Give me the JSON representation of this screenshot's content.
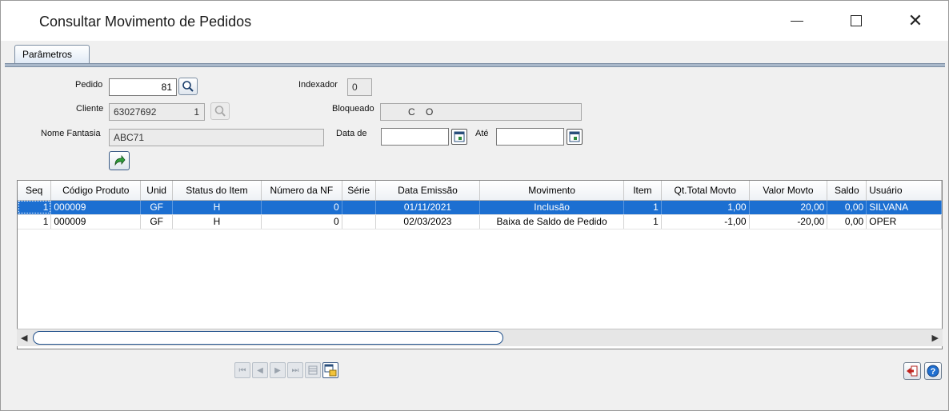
{
  "window": {
    "title": "Consultar Movimento de Pedidos",
    "minimize_glyph": "—",
    "close_glyph": "✕"
  },
  "tabs": [
    {
      "label": "Parâmetros"
    }
  ],
  "form": {
    "pedido_label": "Pedido",
    "pedido_value": "81",
    "indexador_label": "Indexador",
    "indexador_value": "0",
    "cliente_label": "Cliente",
    "cliente_code": "63027692",
    "cliente_num": "1",
    "bloqueado_label": "Bloqueado",
    "bloqueado_value": "C    O",
    "nome_fantasia_label": "Nome Fantasia",
    "nome_fantasia_value": "ABC71",
    "data_de_label": "Data de",
    "data_de_value": "",
    "ate_label": "Até",
    "ate_value": ""
  },
  "grid": {
    "columns": [
      "Seq",
      "Código Produto",
      "Unid",
      "Status do Item",
      "Número da NF",
      "Série",
      "Data Emissão",
      "Movimento",
      "Item",
      "Qt.Total Movto",
      "Valor Movto",
      "Saldo",
      "Usuário"
    ],
    "rows": [
      {
        "seq": "1",
        "codigo": "000009",
        "unid": "GF",
        "status": "H",
        "nf": "0",
        "serie": "",
        "data": "01/11/2021",
        "movimento": "Inclusão",
        "item": "1",
        "qt": "1,00",
        "valor": "20,00",
        "saldo": "0,00",
        "usuario": "SILVANA"
      },
      {
        "seq": "1",
        "codigo": "000009",
        "unid": "GF",
        "status": "H",
        "nf": "0",
        "serie": "",
        "data": "02/03/2023",
        "movimento": "Baixa de Saldo de Pedido",
        "item": "1",
        "qt": "-1,00",
        "valor": "-20,00",
        "saldo": "0,00",
        "usuario": "OPER"
      }
    ],
    "selected_row": 0
  },
  "icons": {
    "search": "search-icon",
    "refresh": "green-arrow-icon",
    "calendar": "calendar-icon",
    "exit": "exit-icon",
    "help": "help-icon"
  },
  "colors": {
    "selection": "#1c6fd1",
    "tab_bar": "#a9b8ca"
  }
}
